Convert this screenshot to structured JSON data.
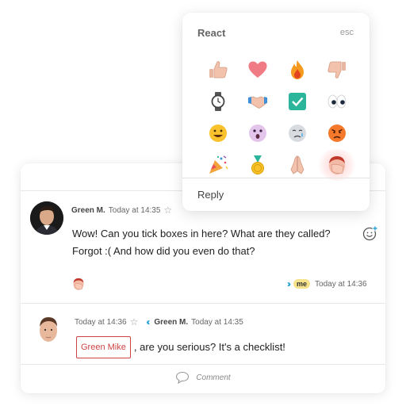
{
  "popup": {
    "title": "React",
    "esc_label": "esc",
    "reply_label": "Reply",
    "emojis": [
      "thumbs-up-icon",
      "heart-icon",
      "fire-icon",
      "thumbs-down-icon",
      "watch-icon",
      "handshake-icon",
      "checkmark-box-icon",
      "eyes-icon",
      "grinning-face-icon",
      "surprised-face-icon",
      "crying-face-icon",
      "angry-face-icon",
      "party-popper-icon",
      "medal-icon",
      "praying-hands-icon",
      "facepalm-icon"
    ],
    "highlighted_emoji": "facepalm-icon"
  },
  "comment1": {
    "author": "Green M.",
    "time": "Today at 14:35",
    "line1": "Wow! Can you tick boxes in here? What are they called?",
    "line2": "Forgot :( And how did you even do that?",
    "reaction": "facepalm-icon",
    "read_badge": "me",
    "read_time": "Today at 14:36"
  },
  "comment2": {
    "time": "Today at 14:36",
    "reply_author": "Green M.",
    "reply_time": "Today at 14:35",
    "mention": "Green Mike",
    "text": ", are you serious? It's a checklist!"
  },
  "footer": {
    "comment_label": "Comment"
  },
  "colors": {
    "accent": "#2aa4d8",
    "mention": "#cc4444",
    "me_badge": "#f6e28a"
  }
}
